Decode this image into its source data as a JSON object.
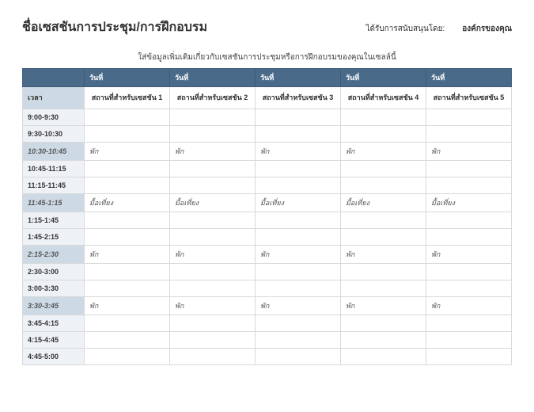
{
  "header": {
    "title": "ชื่อเซสชันการประชุม/การฝึกอบรม",
    "sponsor_label": "ได้รับการสนับสนุนโดย:",
    "sponsor_org": "องค์กรของคุณ"
  },
  "subtitle": "ใส่ข้อมูลเพิ่มเติมเกี่ยวกับเซสชันการประชุมหรือการฝึกอบรมของคุณในเซลล์นี้",
  "columns": {
    "time_header": "เวลา",
    "days": [
      "วันที่",
      "วันที่",
      "วันที่",
      "วันที่",
      "วันที่"
    ],
    "locations": [
      "สถานที่สำหรับเซสชัน 1",
      "สถานที่สำหรับเซสชัน 2",
      "สถานที่สำหรับเซสชัน 3",
      "สถานที่สำหรับเซสชัน 4",
      "สถานที่สำหรับเซสชัน 5"
    ]
  },
  "rows": [
    {
      "time": "9:00-9:30",
      "break": false,
      "cells": [
        "",
        "",
        "",
        "",
        ""
      ]
    },
    {
      "time": "9:30-10:30",
      "break": false,
      "cells": [
        "",
        "",
        "",
        "",
        ""
      ]
    },
    {
      "time": "10:30-10:45",
      "break": true,
      "cells": [
        "พัก",
        "พัก",
        "พัก",
        "พัก",
        "พัก"
      ]
    },
    {
      "time": "10:45-11:15",
      "break": false,
      "cells": [
        "",
        "",
        "",
        "",
        ""
      ]
    },
    {
      "time": "11:15-11:45",
      "break": false,
      "cells": [
        "",
        "",
        "",
        "",
        ""
      ]
    },
    {
      "time": "11:45-1:15",
      "break": true,
      "cells": [
        "มื้อเที่ยง",
        "มื้อเที่ยง",
        "มื้อเที่ยง",
        "มื้อเที่ยง",
        "มื้อเที่ยง"
      ]
    },
    {
      "time": "1:15-1:45",
      "break": false,
      "cells": [
        "",
        "",
        "",
        "",
        ""
      ]
    },
    {
      "time": "1:45-2:15",
      "break": false,
      "cells": [
        "",
        "",
        "",
        "",
        ""
      ]
    },
    {
      "time": "2:15-2:30",
      "break": true,
      "cells": [
        "พัก",
        "พัก",
        "พัก",
        "พัก",
        "พัก"
      ]
    },
    {
      "time": "2:30-3:00",
      "break": false,
      "cells": [
        "",
        "",
        "",
        "",
        ""
      ]
    },
    {
      "time": "3:00-3:30",
      "break": false,
      "cells": [
        "",
        "",
        "",
        "",
        ""
      ]
    },
    {
      "time": "3:30-3:45",
      "break": true,
      "cells": [
        "พัก",
        "พัก",
        "พัก",
        "พัก",
        "พัก"
      ]
    },
    {
      "time": "3:45-4:15",
      "break": false,
      "cells": [
        "",
        "",
        "",
        "",
        ""
      ]
    },
    {
      "time": "4:15-4:45",
      "break": false,
      "cells": [
        "",
        "",
        "",
        "",
        ""
      ]
    },
    {
      "time": "4:45-5:00",
      "break": false,
      "cells": [
        "",
        "",
        "",
        "",
        ""
      ]
    }
  ]
}
